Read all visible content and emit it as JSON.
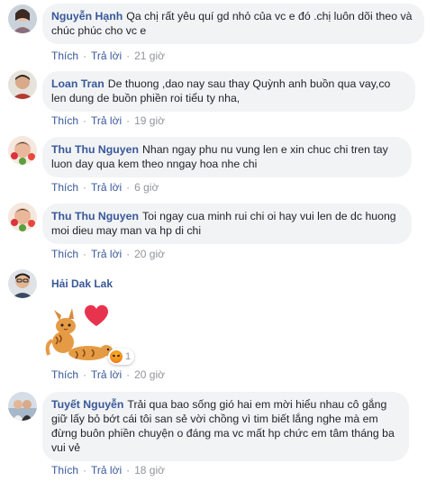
{
  "actions": {
    "like": "Thích",
    "reply": "Trả lời",
    "sep": "·"
  },
  "comments": [
    {
      "author": "Nguyễn Hạnh",
      "text": "Qa chị rất yêu quí gd nhỏ của vc e đó .chị luôn dõi theo và chúc phúc cho vc e",
      "time": "21 giờ"
    },
    {
      "author": "Loan Tran",
      "text": "De thuong ,dao nay sau thay Quỳnh anh buồn qua vay,co len dung de buồn phiền roi tiểu ty nha,",
      "time": "19 giờ"
    },
    {
      "author": "Thu Thu Nguyen",
      "text": "Nhan ngay phu nu vung len e xin chuc chi tren tay luon day qua kem theo nngay hoa nhe chi",
      "time": "6 giờ"
    },
    {
      "author": "Thu Thu Nguyen",
      "text": "Toi ngay cua minh rui chi oi hay vui len de dc huong moi dieu may man va hp di chi",
      "time": "20 giờ"
    },
    {
      "author": "Hải Dak Lak",
      "text": "",
      "time": "20 giờ",
      "reaction": {
        "icon": "angry-reaction-icon",
        "count": "1"
      }
    },
    {
      "author": "Tuyết Nguyễn",
      "text": "Trải qua bao sống gió hai em mời hiểu nhau cô gắng giữ lấy bỏ bớt cái tôi san sẻ vời chồng vì tim biết lắng nghe mà em đừng buôn phiền chuyện o đáng ma vc mất hp chức em tâm tháng ba vui vẻ",
      "time": "18 giờ"
    }
  ],
  "colors": {
    "name": "#385898",
    "bubble": "#f2f3f5",
    "meta": "#90949c"
  }
}
